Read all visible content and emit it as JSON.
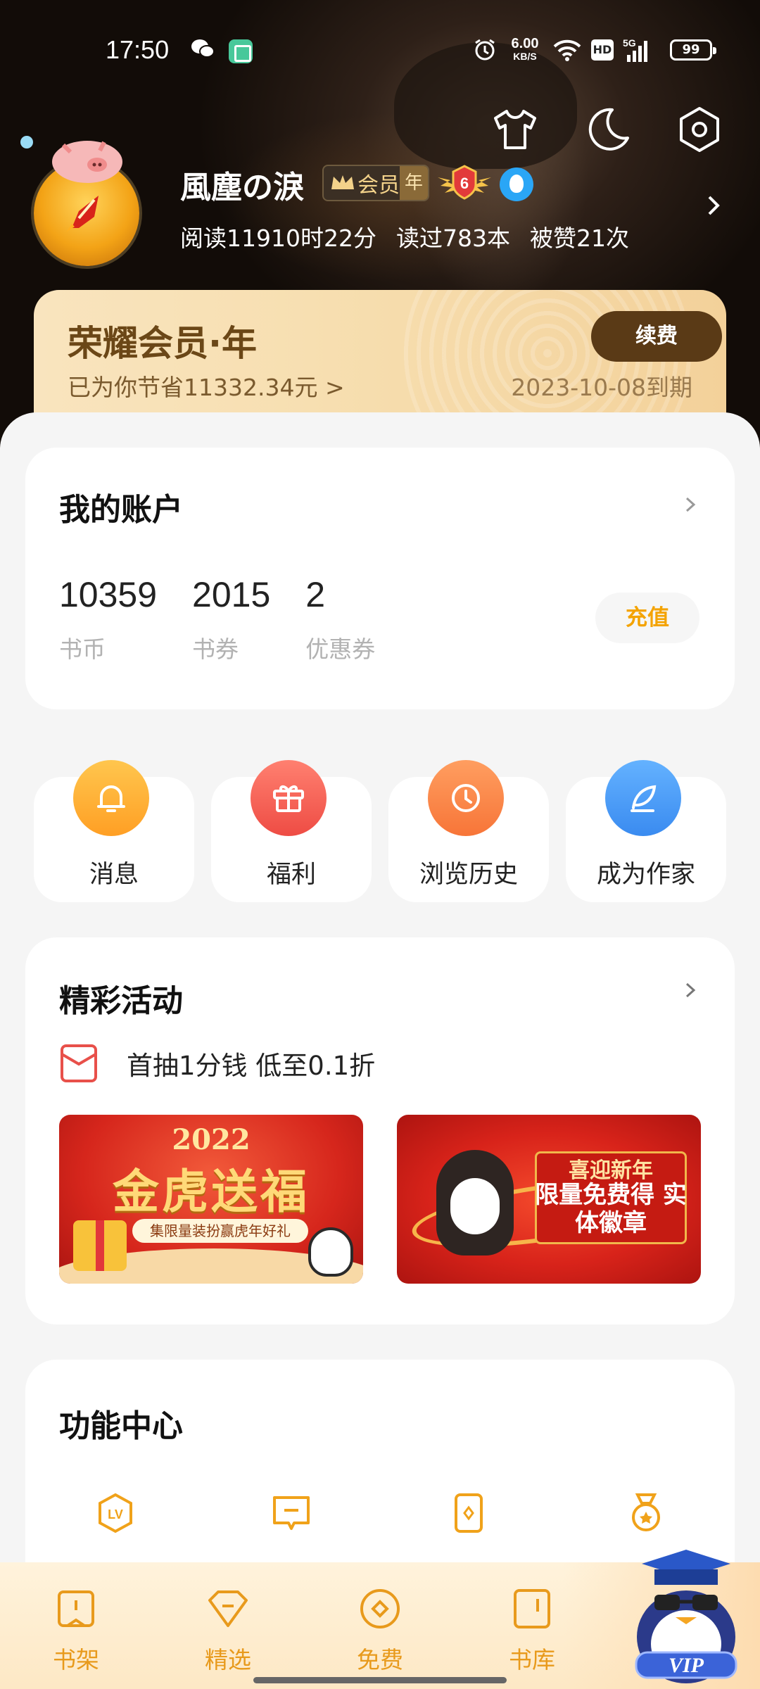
{
  "status_bar": {
    "time": "17:50",
    "net_speed": "6.00",
    "net_unit": "KB/S",
    "hd": "HD",
    "signal": "5G",
    "battery": "99"
  },
  "profile": {
    "nickname": "風塵の淚",
    "vip_label": "会员",
    "vip_period": "年",
    "level": "6",
    "stats": {
      "read_time": "阅读11910时22分",
      "books_read": "读过783本",
      "likes": "被赞21次"
    }
  },
  "vip_card": {
    "title": "荣耀会员·年",
    "saved": "已为你节省11332.34元 >",
    "renew_label": "续费",
    "expire": "2023-10-08到期"
  },
  "account": {
    "title": "我的账户",
    "items": [
      {
        "value": "10359",
        "label": "书币"
      },
      {
        "value": "2015",
        "label": "书券"
      },
      {
        "value": "2",
        "label": "优惠券"
      }
    ],
    "recharge_label": "充值"
  },
  "quick_actions": [
    {
      "label": "消息",
      "icon": "bell-icon",
      "color": "#ffb43a"
    },
    {
      "label": "福利",
      "icon": "gift-icon",
      "color": "#f4685a"
    },
    {
      "label": "浏览历史",
      "icon": "clock-icon",
      "color": "#fb8a4d"
    },
    {
      "label": "成为作家",
      "icon": "feather-icon",
      "color": "#4a9ff5"
    }
  ],
  "events": {
    "title": "精彩活动",
    "promo": "首抽1分钱 低至0.1折",
    "banners": [
      {
        "year": "2022",
        "headline": "金虎送福",
        "subtitle": "集限量装扮赢虎年好礼"
      },
      {
        "line1": "喜迎新年",
        "line2": "限量免费得 实体徽章"
      }
    ]
  },
  "function_center": {
    "title": "功能中心",
    "icons": [
      "level-icon",
      "comment-icon",
      "card-icon",
      "medal-icon"
    ]
  },
  "bottom_nav": [
    {
      "label": "书架",
      "icon": "bookshelf-icon"
    },
    {
      "label": "精选",
      "icon": "featured-icon"
    },
    {
      "label": "免费",
      "icon": "free-icon"
    },
    {
      "label": "书库",
      "icon": "library-icon"
    }
  ],
  "colors": {
    "accent": "#f4a300",
    "nav_text": "#e89a1c",
    "vip_dark": "#5a3a16"
  }
}
